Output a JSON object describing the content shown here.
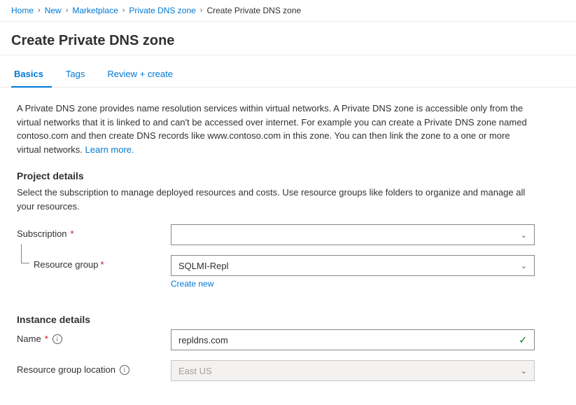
{
  "breadcrumb": {
    "items": [
      {
        "label": "Home",
        "current": false
      },
      {
        "label": "New",
        "current": false
      },
      {
        "label": "Marketplace",
        "current": false
      },
      {
        "label": "Private DNS zone",
        "current": false
      },
      {
        "label": "Create Private DNS zone",
        "current": true
      }
    ]
  },
  "page": {
    "title": "Create Private DNS zone"
  },
  "tabs": [
    {
      "label": "Basics",
      "active": true
    },
    {
      "label": "Tags",
      "active": false
    },
    {
      "label": "Review + create",
      "active": false
    }
  ],
  "description": {
    "main": "A Private DNS zone provides name resolution services within virtual networks. A Private DNS zone is accessible only from the virtual networks that it is linked to and can't be accessed over internet. For example you can create a Private DNS zone named contoso.com and then create DNS records like www.contoso.com in this zone. You can then link the zone to a one or more virtual networks.",
    "learn_more": "Learn more."
  },
  "project_details": {
    "title": "Project details",
    "description": "Select the subscription to manage deployed resources and costs. Use resource groups like folders to organize and manage all your resources.",
    "subscription": {
      "label": "Subscription",
      "required": true,
      "value": "",
      "placeholder": ""
    },
    "resource_group": {
      "label": "Resource group",
      "required": true,
      "value": "SQLMI-Repl",
      "create_new": "Create new"
    }
  },
  "instance_details": {
    "title": "Instance details",
    "name": {
      "label": "Name",
      "required": true,
      "value": "repldns.com",
      "has_info": true
    },
    "resource_group_location": {
      "label": "Resource group location",
      "value": "East US",
      "disabled": true,
      "has_info": true
    }
  },
  "icons": {
    "chevron": "∨",
    "info": "i",
    "check": "✓"
  }
}
